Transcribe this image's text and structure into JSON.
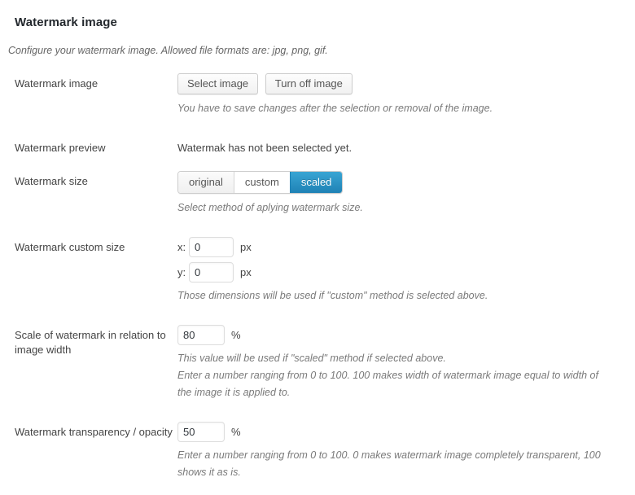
{
  "section": {
    "title": "Watermark image",
    "description": "Configure your watermark image. Allowed file formats are: jpg, png, gif."
  },
  "rows": {
    "watermark_image": {
      "label": "Watermark image",
      "select_button": "Select image",
      "turnoff_button": "Turn off image",
      "description": "You have to save changes after the selection or removal of the image."
    },
    "watermark_preview": {
      "label": "Watermark preview",
      "value": "Watermak has not been selected yet."
    },
    "watermark_size": {
      "label": "Watermark size",
      "options": [
        "original",
        "custom",
        "scaled"
      ],
      "selected": "scaled",
      "description": "Select method of aplying watermark size."
    },
    "custom_size": {
      "label": "Watermark custom size",
      "x_key": "x:",
      "x_value": "0",
      "x_unit": "px",
      "y_key": "y:",
      "y_value": "0",
      "y_unit": "px",
      "description": "Those dimensions will be used if \"custom\" method is selected above."
    },
    "scale": {
      "label": "Scale of watermark in relation to image width",
      "value": "80",
      "unit": "%",
      "description_1": "This value will be used if \"scaled\" method if selected above.",
      "description_2": "Enter a number ranging from 0 to 100. 100 makes width of watermark image equal to width of the image it is applied to."
    },
    "transparency": {
      "label": "Watermark transparency / opacity",
      "value": "50",
      "unit": "%",
      "description": "Enter a number ranging from 0 to 100. 0 makes watermark image completely transparent, 100 shows it as is."
    }
  },
  "colors": {
    "accent": "#1f82b5",
    "accent_light": "#39a5d4",
    "title": "#23282d",
    "text": "#444444",
    "muted": "#7a7a7a",
    "border": "#cccccc"
  }
}
